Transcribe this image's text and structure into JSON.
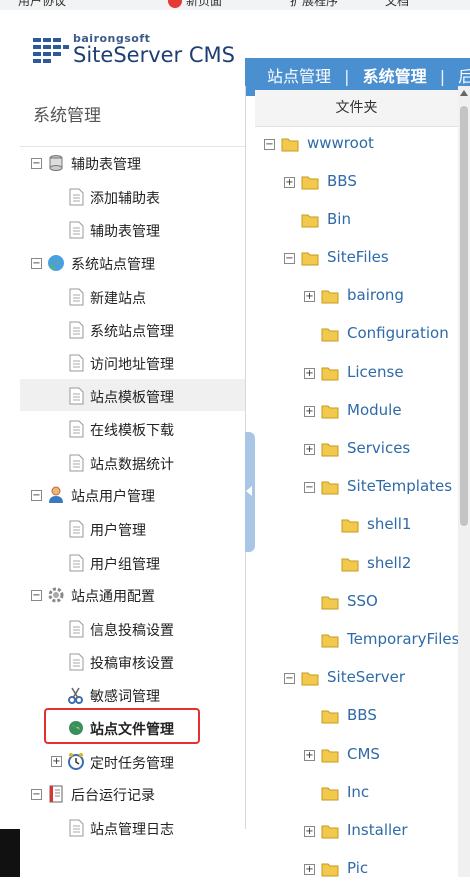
{
  "bookmarks": [
    "用户协议",
    "新页面",
    "扩展程序",
    "文档"
  ],
  "logo": {
    "small": "bairongsoft",
    "big": "SiteServer CMS"
  },
  "topnav": {
    "items": [
      "站点管理",
      "系统管理",
      "后"
    ],
    "separator": "|"
  },
  "sidebar": {
    "title": "系统管理",
    "groups": [
      {
        "label": "辅助表管理",
        "icon": "database-icon",
        "items": [
          "添加辅助表",
          "辅助表管理"
        ]
      },
      {
        "label": "系统站点管理",
        "icon": "globe-icon",
        "items": [
          "新建站点",
          "系统站点管理",
          "访问地址管理",
          "站点模板管理",
          "在线模板下载",
          "站点数据统计"
        ]
      },
      {
        "label": "站点用户管理",
        "icon": "user-icon",
        "items": [
          "用户管理",
          "用户组管理"
        ]
      },
      {
        "label": "站点通用配置",
        "icon": "gear-icon",
        "items": [
          "信息投稿设置",
          "投稿审核设置",
          "敏感词管理",
          "站点文件管理",
          "定时任务管理"
        ]
      },
      {
        "label": "后台运行记录",
        "icon": "log-icon",
        "items": [
          "站点管理日志"
        ]
      }
    ]
  },
  "folders": {
    "header": "文件夹",
    "tree": [
      "wwwroot",
      "BBS",
      "Bin",
      "SiteFiles",
      "bairong",
      "Configuration",
      "License",
      "Module",
      "Services",
      "SiteTemplates",
      "shell1",
      "shell2",
      "SSO",
      "TemporaryFiles",
      "SiteServer",
      "BBS",
      "CMS",
      "Inc",
      "Installer",
      "Pic"
    ]
  },
  "colors": {
    "accent": "#4a8fd0",
    "highlight": "#e53030",
    "folder": "#f2c94c",
    "link": "#2f6aa8"
  }
}
